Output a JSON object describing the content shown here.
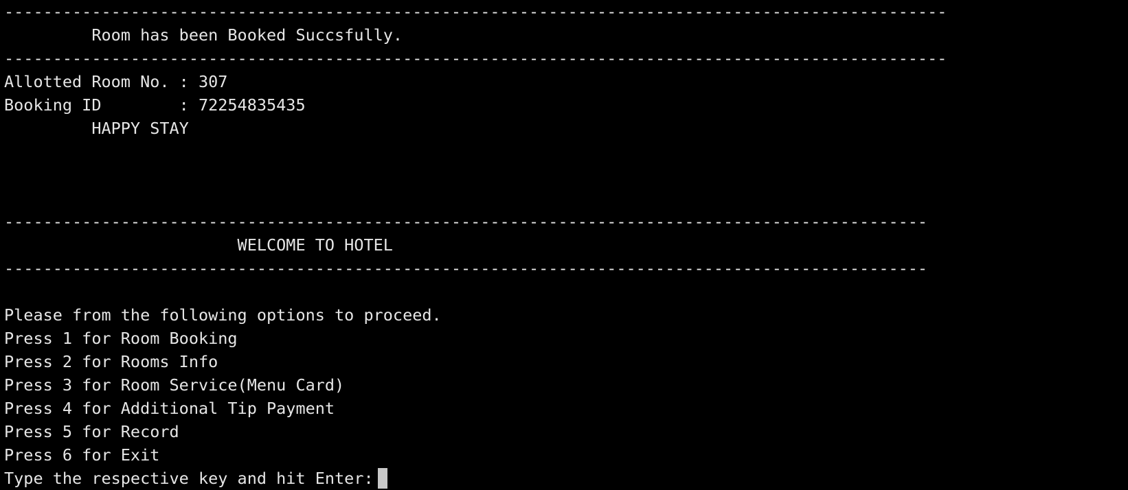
{
  "terminal": {
    "booking_block": {
      "divider_top": "-------------------------------------------------------------------------------------------------",
      "message": "         Room has been Booked Succsfully.",
      "divider_bottom": "-------------------------------------------------------------------------------------------------",
      "room_line": "Allotted Room No. : 307",
      "booking_line": "Booking ID        : 72254835435",
      "happy_stay": "         HAPPY STAY"
    },
    "welcome_block": {
      "divider_top": "-----------------------------------------------------------------------------------------------",
      "title": "                        WELCOME TO HOTEL",
      "divider_bottom": "-----------------------------------------------------------------------------------------------"
    },
    "menu": {
      "intro": "Please from the following options to proceed.",
      "options": [
        "Press 1 for Room Booking",
        "Press 2 for Rooms Info",
        "Press 3 for Room Service(Menu Card)",
        "Press 4 for Additional Tip Payment",
        "Press 5 for Record",
        "Press 6 for Exit"
      ],
      "prompt": "Type the respective key and hit Enter:"
    }
  }
}
